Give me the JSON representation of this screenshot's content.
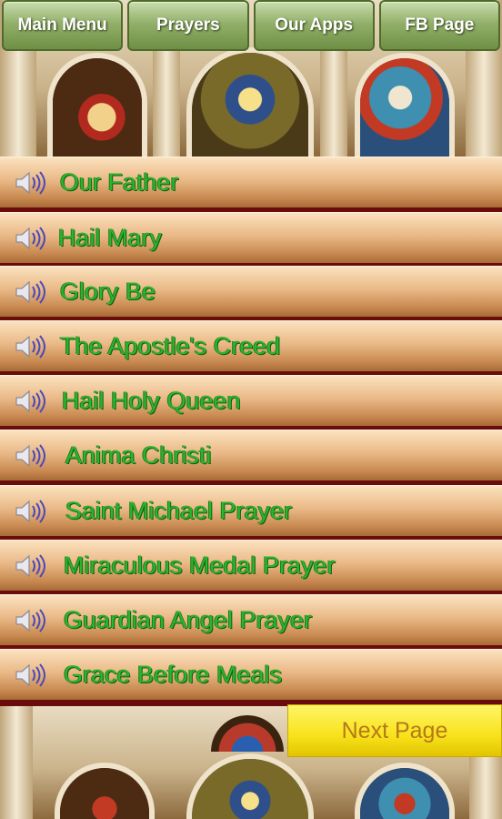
{
  "nav": {
    "main_menu": "Main Menu",
    "prayers": "Prayers",
    "our_apps": "Our Apps",
    "fb_page": "FB Page"
  },
  "prayers": [
    "Our Father",
    "Hail Mary",
    "Glory Be",
    "The Apostle's Creed",
    "Hail Holy Queen",
    "Anima Christi",
    "Saint Michael Prayer",
    "Miraculous Medal Prayer",
    "Guardian Angel Prayer",
    "Grace Before Meals"
  ],
  "row_icon": "speaker-icon",
  "next_page": "Next Page",
  "colors": {
    "nav_button": "#7f9e55",
    "row_label": "#2bb52b",
    "row_divider": "#6a0c0c",
    "next_button": "#f8e21a",
    "next_text": "#b4791a"
  }
}
